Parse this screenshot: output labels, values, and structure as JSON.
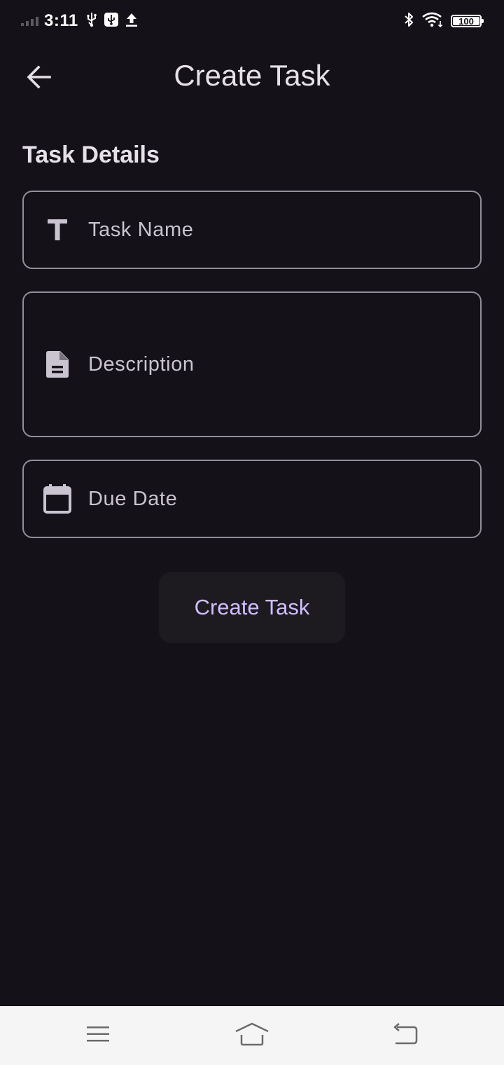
{
  "status_bar": {
    "time": "3:11",
    "battery_level": "100",
    "icons": [
      "signal-icon",
      "usb-icon",
      "usb-debug-icon",
      "upload-icon",
      "bluetooth-icon",
      "wifi-icon",
      "battery-icon"
    ]
  },
  "app_bar": {
    "title": "Create Task",
    "back_icon": "arrow-back-icon"
  },
  "form": {
    "section_title": "Task Details",
    "task_name": {
      "placeholder": "Task Name",
      "value": "",
      "icon": "text-format-icon"
    },
    "description": {
      "placeholder": "Description",
      "value": "",
      "icon": "document-icon"
    },
    "due_date": {
      "placeholder": "Due Date",
      "value": "",
      "icon": "calendar-icon"
    },
    "submit_label": "Create Task"
  },
  "nav_bar": {
    "items": [
      "menu-icon",
      "home-icon",
      "back-icon"
    ]
  },
  "colors": {
    "background": "#141218",
    "on_surface": "#E6E0E9",
    "outline": "#938F99",
    "placeholder": "#CAC4D0",
    "primary": "#D0BCFF",
    "button_surface": "#1D1B20",
    "nav_bar": "#F5F5F5"
  }
}
